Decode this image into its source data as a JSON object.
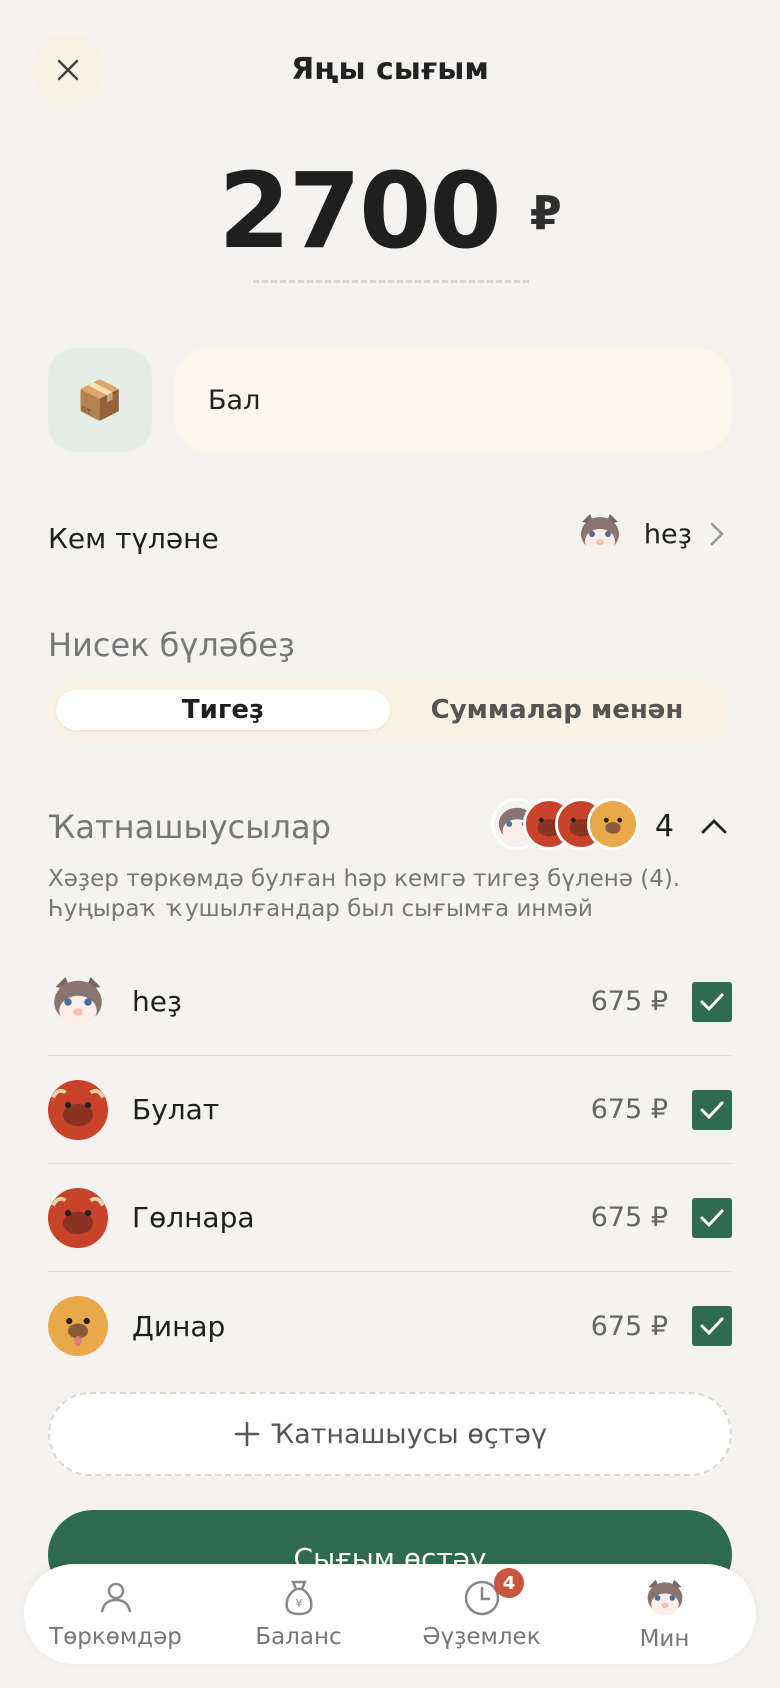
{
  "header": {
    "title": "Яңы сығым"
  },
  "amount": {
    "value": "2700",
    "currency": "₽"
  },
  "expense": {
    "category_icon": "box-icon",
    "description": "Бал"
  },
  "payer": {
    "label": "Кем түләне",
    "name": "һеҙ",
    "avatar": "cat-avatar"
  },
  "split": {
    "label": "Нисек бүләбеҙ",
    "options": [
      "Тигеҙ",
      "Суммалар менән"
    ],
    "selected": "Тигеҙ"
  },
  "participants": {
    "label": "Ҡатнашыусылар",
    "count": "4",
    "note": "Хәҙер төркөмдә булған һәр кемгә тигеҙ бүленә (4). Һуңыраҡ ҡушылғандар был сығымға инмәй",
    "items": [
      {
        "name": "һеҙ",
        "amount": "675 ₽",
        "avatar": "cat-avatar",
        "checked": true
      },
      {
        "name": "Булат",
        "amount": "675 ₽",
        "avatar": "bull-avatar",
        "checked": true
      },
      {
        "name": "Гөлнара",
        "amount": "675 ₽",
        "avatar": "bull-avatar",
        "checked": true
      },
      {
        "name": "Динар",
        "amount": "675 ₽",
        "avatar": "dog-avatar",
        "checked": true
      }
    ],
    "add_label": "Ҡатнашыусы өҫтәү"
  },
  "submit_label": "Сығым өҫтәү",
  "tabs": [
    {
      "label": "Төркөмдәр",
      "icon": "people-icon"
    },
    {
      "label": "Баланс",
      "icon": "money-bag-icon"
    },
    {
      "label": "Әүҙемлек",
      "icon": "clock-icon",
      "badge": "4"
    },
    {
      "label": "Мин",
      "icon": "cat-avatar"
    }
  ],
  "colors": {
    "accent": "#2f6b4f",
    "badge": "#c8553d",
    "background": "#f5f3ef"
  }
}
